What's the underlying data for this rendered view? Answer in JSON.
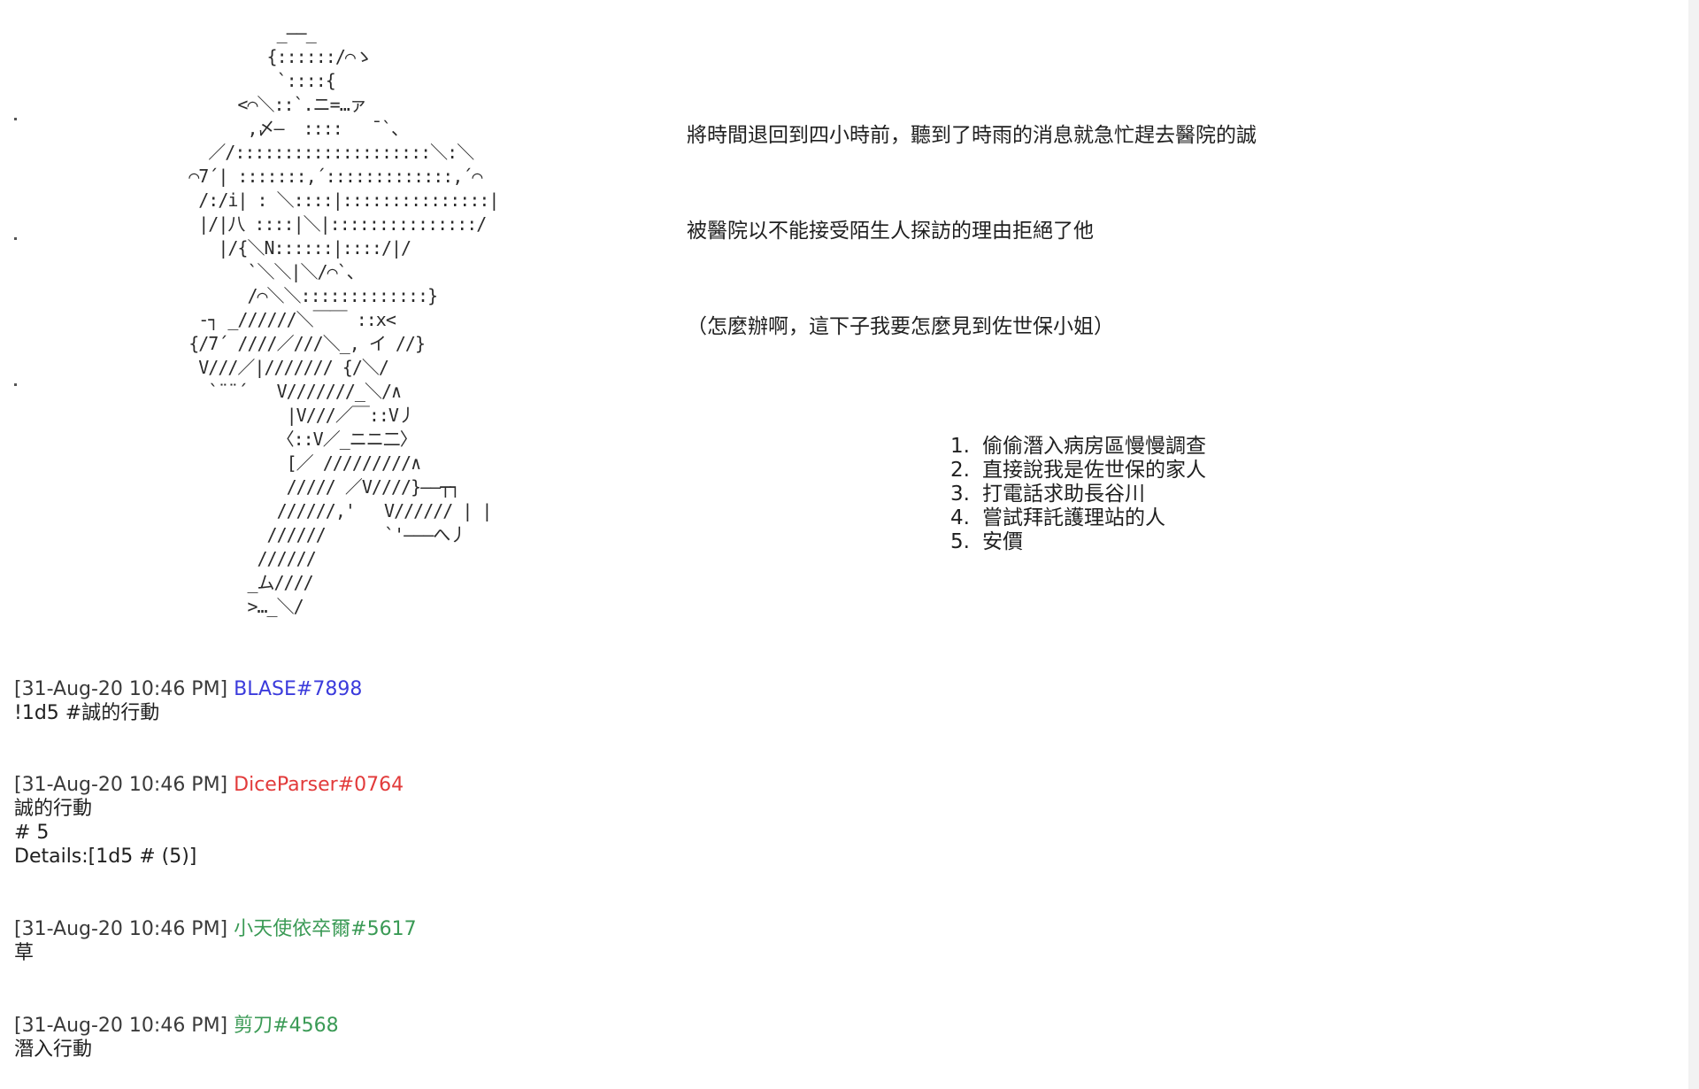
{
  "ascii_art": {
    "lines": [
      "              _——_",
      "             {::::::/⌒ゝ",
      "              `::::{",
      "          <⌒＼::`.ニ=…ァ",
      "           ,〆—  ::::   ¯`、",
      "       ／/::::::::::::::::::::＼:＼",
      "     ⌒7´| :::::::,´:::::::::::::,´⌒",
      "      /:/i| : ＼::::|:::::::::::::::|",
      "      |/|八 ::::|＼|:::::::::::::::/",
      "        |/{＼N::::::|::::/|/",
      "           `＼＼|＼/⌒`、",
      "           /⌒＼＼:::::::::::::}",
      "      ‐┐ _//////＼￣￣ ::x<",
      "     {/7´ ////／///＼_, イ //}",
      "      V///／|/////// {/＼/",
      "       `¨¨´   V///////_＼/∧",
      "               |V///／￣::V丿",
      "              〈::V／_ニニ二〉",
      "               [／ /////////∧",
      "               ///// ／V////}——┬┐",
      "              //////,'   V////// | |",
      "             //////      `'———へ丿",
      "            //////",
      "           _ム////",
      "           >…_＼/"
    ]
  },
  "narration": {
    "line1": "將時間退回到四小時前，聽到了時雨的消息就急忙趕去醫院的誠",
    "line2": "被醫院以不能接受陌生人探訪的理由拒絕了他",
    "line3": "（怎麼辦啊，這下子我要怎麼見到佐世保小姐）"
  },
  "choices": [
    {
      "num": "1.",
      "text": "偷偷潛入病房區慢慢調查"
    },
    {
      "num": "2.",
      "text": "直接說我是佐世保的家人"
    },
    {
      "num": "3.",
      "text": "打電話求助長谷川"
    },
    {
      "num": "4.",
      "text": "嘗試拜託護理站的人"
    },
    {
      "num": "5.",
      "text": "安價"
    }
  ],
  "messages": [
    {
      "timestamp": "[31-Aug-20 10:46 PM]",
      "user": "BLASE#7898",
      "user_color": "#3b3bdc",
      "lines": [
        "!1d5 #誠的行動"
      ]
    },
    {
      "timestamp": "[31-Aug-20 10:46 PM]",
      "user": "DiceParser#0764",
      "user_color": "#e23a3a",
      "lines": [
        "誠的行動",
        "# 5",
        "Details:[1d5 # (5)]"
      ]
    },
    {
      "timestamp": "[31-Aug-20 10:46 PM]",
      "user": "小天使依卒爾#5617",
      "user_color": "#3a9a55",
      "lines": [
        "草"
      ]
    },
    {
      "timestamp": "[31-Aug-20 10:46 PM]",
      "user": "剪刀#4568",
      "user_color": "#3a9a55",
      "lines": [
        "潛入行動"
      ]
    }
  ]
}
